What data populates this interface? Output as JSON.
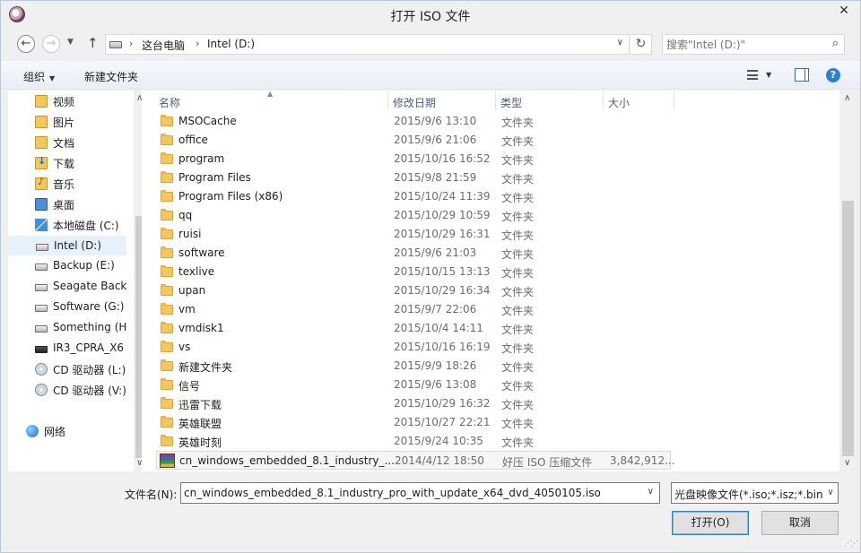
{
  "window": {
    "title": "打开 ISO 文件",
    "close_glyph": "✕"
  },
  "address": {
    "crumbs": [
      "这台电脑",
      "Intel (D:)"
    ]
  },
  "search": {
    "placeholder": "搜索\"Intel (D:)\""
  },
  "toolbar": {
    "organize_label": "组织",
    "new_folder_label": "新建文件夹"
  },
  "sidebar": {
    "items": [
      {
        "label": "视频",
        "icon": "video-library-icon"
      },
      {
        "label": "图片",
        "icon": "picture-library-icon"
      },
      {
        "label": "文档",
        "icon": "document-library-icon"
      },
      {
        "label": "下载",
        "icon": "download-library-icon"
      },
      {
        "label": "音乐",
        "icon": "music-library-icon"
      },
      {
        "label": "桌面",
        "icon": "desktop-icon"
      },
      {
        "label": "本地磁盘 (C:)",
        "icon": "system-drive-icon"
      },
      {
        "label": "Intel (D:)",
        "icon": "drive-icon"
      },
      {
        "label": "Backup (E:)",
        "icon": "drive-icon"
      },
      {
        "label": "Seagate Back",
        "icon": "drive-icon"
      },
      {
        "label": "Software (G:)",
        "icon": "drive-icon"
      },
      {
        "label": "Something (H",
        "icon": "drive-icon"
      },
      {
        "label": "IR3_CPRA_X6",
        "icon": "dark-drive-icon"
      },
      {
        "label": "CD 驱动器 (L:)",
        "icon": "cd-drive-icon"
      },
      {
        "label": "CD 驱动器 (V:)",
        "icon": "cd-drive-icon"
      },
      {
        "label": "网络",
        "icon": "network-icon"
      }
    ],
    "selected_index": 7
  },
  "columns": {
    "name": "名称",
    "date": "修改日期",
    "type": "类型",
    "size": "大小"
  },
  "files": [
    {
      "name": "MSOCache",
      "date": "2015/9/6 13:10",
      "type": "文件夹",
      "size": ""
    },
    {
      "name": "office",
      "date": "2015/9/6 21:06",
      "type": "文件夹",
      "size": ""
    },
    {
      "name": "program",
      "date": "2015/10/16 16:52",
      "type": "文件夹",
      "size": ""
    },
    {
      "name": "Program Files",
      "date": "2015/9/8 21:59",
      "type": "文件夹",
      "size": ""
    },
    {
      "name": "Program Files (x86)",
      "date": "2015/10/24 11:39",
      "type": "文件夹",
      "size": ""
    },
    {
      "name": "qq",
      "date": "2015/10/29 10:59",
      "type": "文件夹",
      "size": ""
    },
    {
      "name": "ruisi",
      "date": "2015/10/29 16:31",
      "type": "文件夹",
      "size": ""
    },
    {
      "name": "software",
      "date": "2015/9/6 21:03",
      "type": "文件夹",
      "size": ""
    },
    {
      "name": "texlive",
      "date": "2015/10/15 13:13",
      "type": "文件夹",
      "size": ""
    },
    {
      "name": "upan",
      "date": "2015/10/29 16:34",
      "type": "文件夹",
      "size": ""
    },
    {
      "name": "vm",
      "date": "2015/9/7 22:06",
      "type": "文件夹",
      "size": ""
    },
    {
      "name": "vmdisk1",
      "date": "2015/10/4 14:11",
      "type": "文件夹",
      "size": ""
    },
    {
      "name": "vs",
      "date": "2015/10/16 16:19",
      "type": "文件夹",
      "size": ""
    },
    {
      "name": "新建文件夹",
      "date": "2015/9/9 18:26",
      "type": "文件夹",
      "size": ""
    },
    {
      "name": "信号",
      "date": "2015/9/6 13:08",
      "type": "文件夹",
      "size": ""
    },
    {
      "name": "迅雷下载",
      "date": "2015/10/29 16:32",
      "type": "文件夹",
      "size": ""
    },
    {
      "name": "英雄联盟",
      "date": "2015/10/27 22:21",
      "type": "文件夹",
      "size": ""
    },
    {
      "name": "英雄时刻",
      "date": "2015/9/24 10:35",
      "type": "文件夹",
      "size": ""
    },
    {
      "name": "cn_windows_embedded_8.1_industry_...",
      "date": "2014/4/12 18:50",
      "type": "好压 ISO 压缩文件",
      "size": "3,842,912...",
      "icon": "haozip-archive-icon",
      "selected": true
    }
  ],
  "footer": {
    "filename_label": "文件名(N):",
    "filename_value": "cn_windows_embedded_8.1_industry_pro_with_update_x64_dvd_4050105.iso",
    "filter_value": "光盘映像文件(*.iso;*.isz;*.bin;*",
    "open_label": "打开(O)",
    "cancel_label": "取消"
  },
  "colors": {
    "accent": "#2e7fd2",
    "selection": "#e5f1fb",
    "column_header": "#4c607a"
  }
}
